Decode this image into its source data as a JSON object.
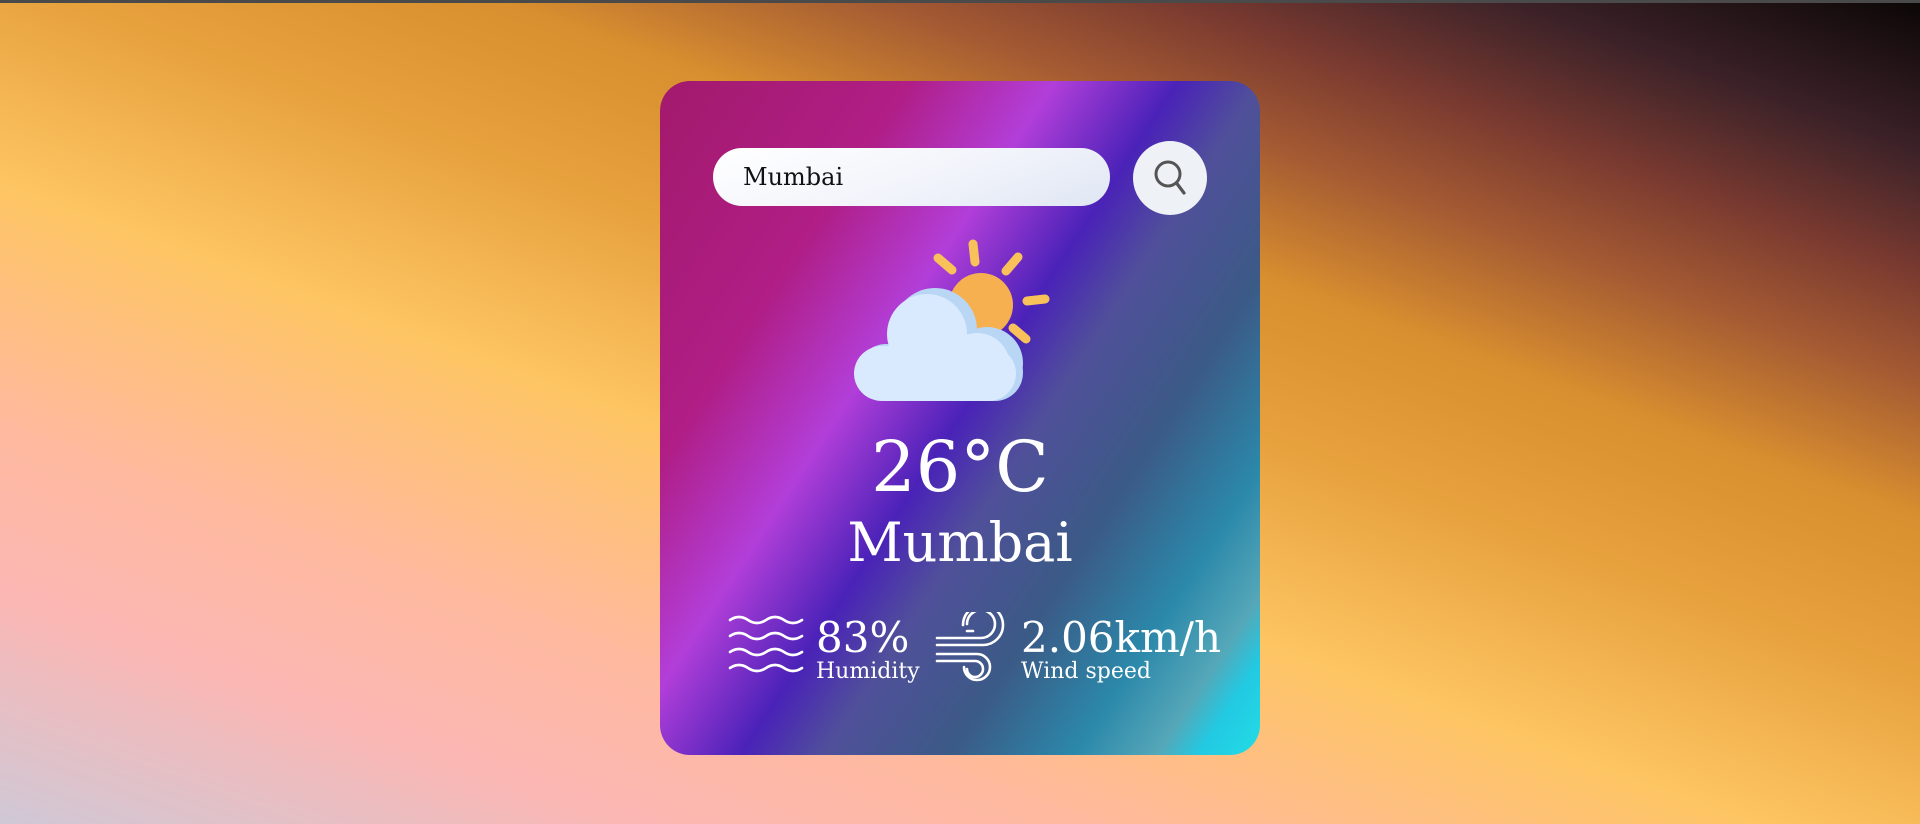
{
  "search": {
    "value": "Mumbai",
    "button_icon": "search-icon"
  },
  "weather": {
    "icon": "partly-cloudy-icon",
    "temperature": "26°C",
    "city": "Mumbai"
  },
  "details": {
    "humidity": {
      "icon": "humidity-waves-icon",
      "value": "83%",
      "label": "Humidity"
    },
    "wind": {
      "icon": "wind-icon",
      "value": "2.06km/h",
      "label": "Wind speed"
    }
  },
  "colors": {
    "sun": "#f6b04f",
    "cloud": "#d9eaff",
    "card_accent": "#22dde6"
  }
}
